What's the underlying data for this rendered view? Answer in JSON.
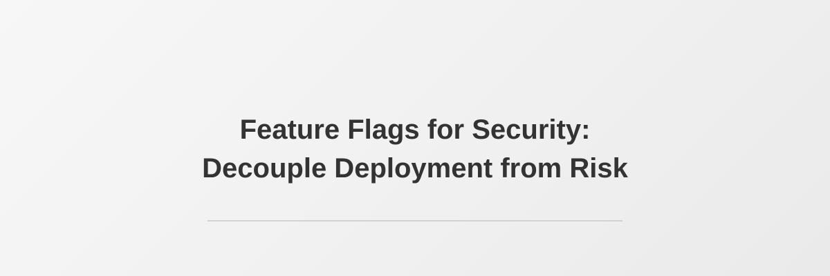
{
  "title": {
    "line1": "Feature Flags for Security:",
    "line2": "Decouple Deployment from Risk"
  },
  "colors": {
    "text": "#333333",
    "divider": "#d2d2d2",
    "background": "#f1f1f1"
  }
}
